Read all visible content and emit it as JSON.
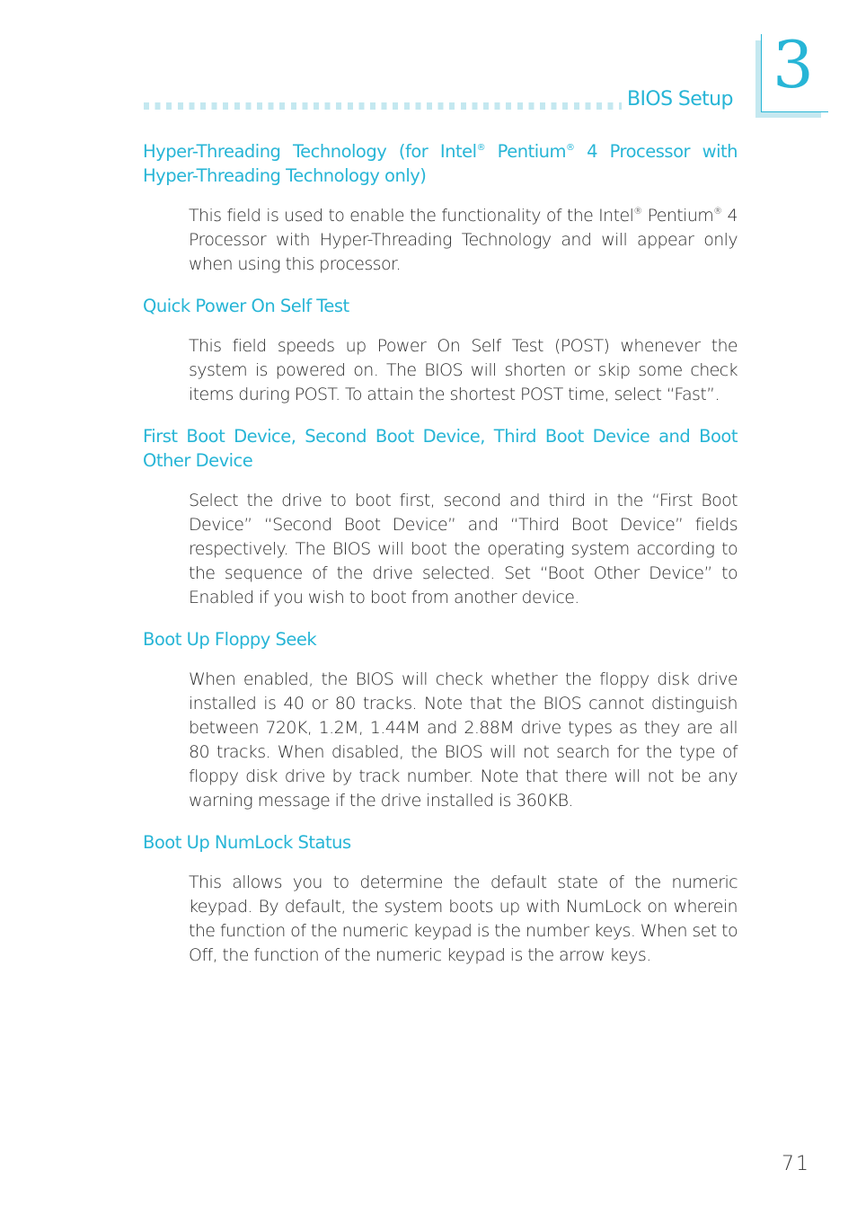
{
  "header": {
    "running_title": "BIOS Setup",
    "chapter_number": "3"
  },
  "sections": [
    {
      "title_parts": [
        "Hyper-Threading Technology (for Intel",
        "®",
        " Pentium",
        "®",
        " 4 Processor with Hyper-Threading Technology only)"
      ],
      "body_parts": [
        "This field is used to enable the functionality of the Intel",
        "®",
        " Pentium",
        "®",
        " 4 Processor with Hyper-Threading Technology and will appear only when using this processor."
      ]
    },
    {
      "title": "Quick Power On Self Test",
      "body": "This field speeds up Power On Self Test (POST) whenever the system is powered on. The BIOS will shorten or skip some check items during POST. To attain the shortest POST time, select “Fast”."
    },
    {
      "title": "First Boot Device, Second Boot Device, Third Boot Device and Boot Other Device",
      "body": "Select the drive to boot first, second and third in the “First Boot Device” “Second Boot Device” and “Third Boot Device” fields respectively. The BIOS will boot the operating system according to the sequence of the drive selected. Set “Boot Other Device” to Enabled if you wish to boot from another device."
    },
    {
      "title": "Boot Up Floppy Seek",
      "body": "When enabled, the BIOS will check whether the floppy disk drive installed is 40 or 80 tracks. Note that the BIOS cannot distinguish between 720K, 1.2M, 1.44M and 2.88M drive types as they are all 80 tracks. When disabled, the BIOS will not search for the type of floppy disk drive by track number. Note that there will not be any warning message if the drive installed is 360KB."
    },
    {
      "title": "Boot Up NumLock Status",
      "body": "This allows you to determine the default state of the numeric keypad. By default, the system boots up with NumLock on wherein the function of the numeric keypad is the number keys. When set to Off, the function of the numeric keypad is the arrow keys."
    }
  ],
  "footer": {
    "page_number": "71"
  },
  "colors": {
    "accent": "#27b5d6",
    "accent_light": "#c4e8f0",
    "body_text": "#2b2b2b"
  }
}
